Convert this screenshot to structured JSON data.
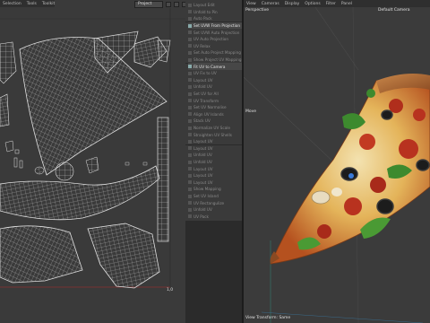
{
  "uv_editor": {
    "menu": [
      "Selection",
      "Tools",
      "Toolkit"
    ],
    "view_select": "Project",
    "bottom_readout": "1,0"
  },
  "tool_menu": {
    "items": [
      {
        "label": "Layout Edit"
      },
      {
        "label": "Unfold to Pin"
      },
      {
        "label": "Auto Pack"
      },
      {
        "label": "Set UVW From Projection",
        "active": true
      },
      {
        "label": "Set UVW Auto Projection"
      },
      {
        "label": "UV Auto Projection"
      },
      {
        "label": "UV Relax"
      },
      {
        "label": "Set Auto Project Mapping"
      },
      {
        "label": "Show Project UV Mapping"
      },
      {
        "label": "Fit UV to Camera",
        "active": true
      },
      {
        "label": "UV Fix to UV"
      },
      {
        "label": "Layout UV"
      },
      {
        "label": "Unfold UV"
      },
      {
        "label": "Set UV for All"
      },
      {
        "label": "UV Transform"
      },
      {
        "label": "Set UV Normalise"
      },
      {
        "label": "Align UV Islands"
      },
      {
        "label": "Stack UV"
      },
      {
        "label": "Normalize UV Scale"
      },
      {
        "label": "Straighten UV Shells"
      },
      {
        "label": "Layout UV"
      },
      {
        "label": "Layout UV"
      },
      {
        "label": "Unfold UV"
      },
      {
        "label": "Unfold UV"
      },
      {
        "label": "Layout UV"
      },
      {
        "label": "Layout UV"
      },
      {
        "label": "Layout UV"
      },
      {
        "label": "Show Mapping"
      },
      {
        "label": "Set UV Island"
      },
      {
        "label": "UV Rectangulize"
      },
      {
        "label": "Unfold UV"
      },
      {
        "label": "UV Pack"
      }
    ]
  },
  "viewport": {
    "menu": [
      "View",
      "Cameras",
      "Display",
      "Options",
      "Filter",
      "Panel"
    ],
    "view_name": "Perspective",
    "camera_label": "Default Camera",
    "move_label": "Move",
    "transform_label": "View Transform: Same"
  },
  "colors": {
    "uv_bg": "#3a3a3a",
    "uv_wire": "#cfcfcf",
    "viewport_bg": "#3b3b3b",
    "pizza_cheese": "#e0b24a",
    "pepperoni": "#b8321f",
    "olive": "#1c1c1c",
    "pepper": "#3d8a2e"
  }
}
